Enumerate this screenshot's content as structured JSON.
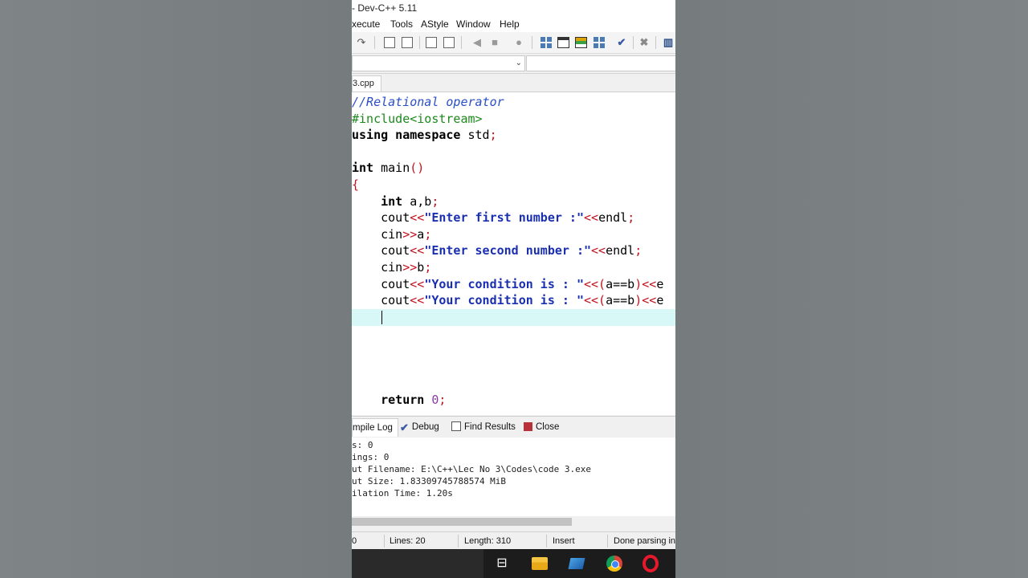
{
  "window": {
    "title": "- Dev-C++ 5.11"
  },
  "menu": [
    "xecute",
    "Tools",
    "AStyle",
    "Window",
    "Help"
  ],
  "editor_tab": {
    "label": "3.cpp"
  },
  "code": {
    "comment": "//Relational operator",
    "include": "#include<iostream>",
    "using_kw": "using namespace",
    "using_rest": " std",
    "int_kw": "int",
    "main_name": " main",
    "brace_open": "{",
    "decl_rest": " a,b",
    "cout": "cout",
    "cin": "cin",
    "endl": "endl",
    "str_first": "\"Enter first number :\"",
    "str_second": "\"Enter second number :\"",
    "str_cond": "\"Your condition is : \"",
    "var_a": "a",
    "var_b": "b",
    "cond_expr": "a==b",
    "cond_tail": "e",
    "return_kw": "return",
    "return_val": "0"
  },
  "bottom_tabs": {
    "compile_log": "mpile Log",
    "debug": "Debug",
    "find_results": "Find Results",
    "close": "Close"
  },
  "log_lines": [
    "s: 0",
    "ings: 0",
    "ut Filename: E:\\C++\\Lec No 3\\Codes\\code 3.exe",
    "ut Size: 1.83309745788574 MiB",
    "ilation Time: 1.20s"
  ],
  "status": {
    "col": "0",
    "lines": "Lines:   20",
    "length": "Length:  310",
    "mode": "Insert",
    "parse": "Done parsing in"
  },
  "colors": {
    "string": "#1a2fb0",
    "operator": "#c1121f",
    "comment": "#2a4fc7",
    "preprocessor": "#1b8a1b",
    "current_line": "#d8f8f8"
  }
}
